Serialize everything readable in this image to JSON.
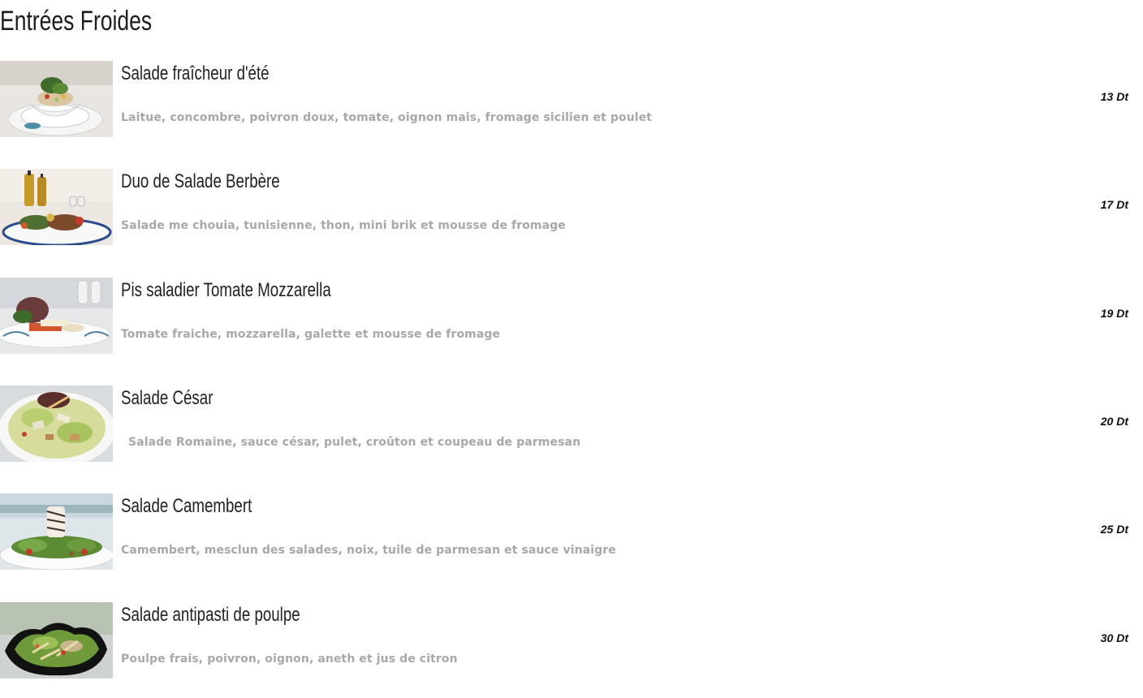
{
  "section": {
    "title": "Entrées Froides"
  },
  "items": [
    {
      "name": "Salade fraîcheur d'été",
      "description": "Laitue, concombre, poivron doux, tomate, oignon mais, fromage sicilien et poulet",
      "price": "13 Dt"
    },
    {
      "name": "Duo de Salade Berbère",
      "description": "Salade me chouia, tunisienne, thon, mini brik et mousse de fromage",
      "price": "17 Dt"
    },
    {
      "name": "Pis saladier Tomate Mozzarella",
      "description": "Tomate fraiche, mozzarella, galette et mousse de fromage",
      "price": "19 Dt"
    },
    {
      "name": "Salade César",
      "description": "Salade Romaine, sauce césar, pulet, croûton et coupeau de parmesan",
      "price": "20 Dt"
    },
    {
      "name": "Salade Camembert",
      "description": "Camembert, mesclun des salades, noix, tuile de parmesan et sauce vinaigre",
      "price": "25 Dt"
    },
    {
      "name": "Salade antipasti de poulpe",
      "description": "Poulpe frais, poivron, oignon, aneth et jus de citron",
      "price": "30 Dt"
    }
  ]
}
